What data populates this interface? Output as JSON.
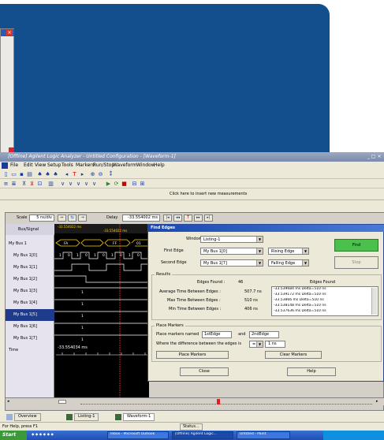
{
  "app": {
    "title": "[Offline] Agilent Logic Analyzer - Untitled Configuration - [Waveform-1]",
    "menu": [
      "File",
      "Edit",
      "View",
      "Setup",
      "Tools",
      "Markers",
      "Run/Stop",
      "Waveform",
      "Window",
      "Help"
    ],
    "measure_hint": "Click here to insert new measurements"
  },
  "scalebar": {
    "scale_label": "Scale",
    "scale_value": "5 ns/div",
    "delay_label": "Delay",
    "delay_value": "-33.554002 ms"
  },
  "signals": {
    "header": "Bus/Signal",
    "rows": [
      {
        "label": "My Bus 1"
      },
      {
        "label": "My Bus 1[0]"
      },
      {
        "label": "My Bus 1[1]"
      },
      {
        "label": "My Bus 1[2]"
      },
      {
        "label": "My Bus 1[3]"
      },
      {
        "label": "My Bus 1[4]"
      },
      {
        "label": "My Bus 1[5]"
      },
      {
        "label": "My Bus 1[6]"
      },
      {
        "label": "My Bus 1[7]"
      },
      {
        "label": "Time"
      }
    ]
  },
  "waveform": {
    "marker_time_1": "-33.554022 ms",
    "marker_time_2": "-33.554022 ms",
    "bus_values": [
      "FA",
      "FF",
      "01"
    ],
    "bit_values": [
      "1",
      "0",
      "1",
      "0",
      "1",
      "0",
      "1",
      "0",
      "1",
      "0"
    ],
    "time_readout": "-33.554034 ms",
    "row_value": "1"
  },
  "dialog": {
    "title": "Find Edges",
    "window_label": "Window",
    "window_value": "Listing-1",
    "first_edge_label": "First Edge",
    "first_edge_value": "My Bus 1[0]",
    "first_edge_type": "Rising Edge",
    "second_edge_label": "Second Edge",
    "second_edge_value": "My Bus 1[7]",
    "second_edge_type": "Falling Edge",
    "find_label": "Find",
    "stop_label": "Stop",
    "results_label": "Results",
    "edges_found_label": "Edges Found :",
    "edges_found_value": "46",
    "avg_label": "Average Time Between Edges :",
    "avg_value": "507.7 ns",
    "max_label": "Max Time Between Edges :",
    "max_value": "510 ns",
    "min_label": "Min Time Between Edges :",
    "min_value": "406 ns",
    "list_header": "Edges Found",
    "list_items": [
      "-33.539684 ms Delta=510 ns",
      "-33.539172 ms Delta=510 ns",
      "-33.53866 ms Delta=510 ns",
      "-33.538148 ms Delta=510 ns",
      "-33.537636 ms Delta=510 ns"
    ],
    "place_markers_group": "Place Markers",
    "place_named_label": "Place markers named",
    "marker1": "1stEdge",
    "and_label": "and",
    "marker2": "2ndEdge",
    "where_label": "Where the difference between the edges is",
    "op_value": "=",
    "diff_value": "1 ns",
    "place_btn": "Place Markers",
    "clear_btn": "Clear Markers",
    "close_btn": "Close",
    "help_btn": "Help"
  },
  "tabs": [
    "Overview",
    "Listing-1",
    "Waveform-1"
  ],
  "status": {
    "left": "For Help, press F1",
    "right": "Status..."
  },
  "taskbar": {
    "start": "Start",
    "tasks": [
      "Inbox - Microsoft Outlook",
      "[Offline] Agilent Logic...",
      "Untitled - Paint"
    ]
  },
  "colors": {
    "blue_panel": "#134f8c",
    "waveform_bg": "#000000",
    "signal_trace": "#ffffff",
    "bus_trace": "#ffd400",
    "selection": "#1f3c8c",
    "find_button": "#4cc04c"
  }
}
